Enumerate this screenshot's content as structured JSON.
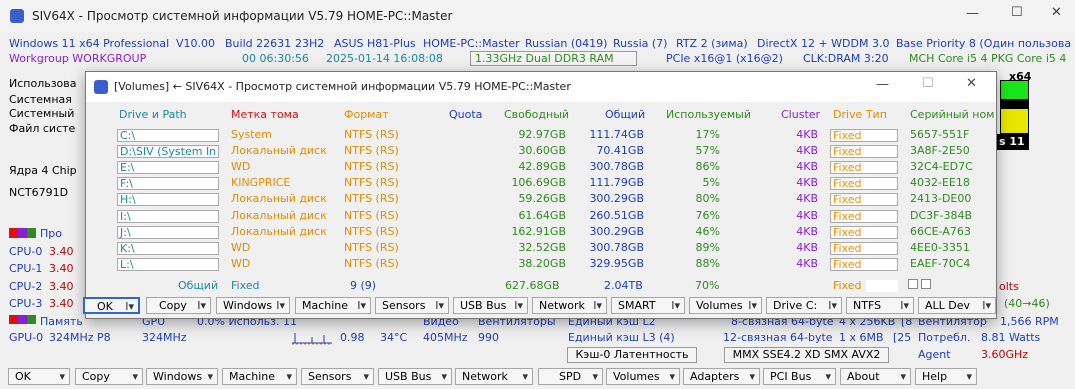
{
  "titlebar": {
    "title": "SIV64X - Просмотр системной информации V5.79 HOME-PC::Master"
  },
  "main": {
    "row1": [
      "Windows 11 x64 Professional",
      "V10.00",
      "Build 22631",
      "23H2",
      "ASUS H81-Plus",
      "HOME-PC::Master",
      "Russian (0419)",
      "Russia (7)",
      "RTZ 2 (зима)",
      "DirectX 12 + WDDM 3.0",
      "Base Priority 8 (Один пользова"
    ],
    "row2": {
      "workgroup": "Workgroup WORKGROUP",
      "uptime": "00 06:30:56",
      "datetime": "2025-01-14 16:08:08",
      "memory": "1.33GHz Dual DDR3 RAM",
      "pcie": "PCIe x16@1 (x16@2)",
      "clk": "CLK:DRAM 3:20",
      "mch": "MCH Core i5 4",
      "pkg": "PKG Core i5 4"
    },
    "left_labels": [
      "Использова",
      "Системная",
      "Системный",
      "Файл систе",
      "Ядра 4 Chip",
      "NCT6791D",
      "Про"
    ],
    "cpu_labels": [
      "CPU-0",
      "CPU-1",
      "CPU-2",
      "CPU-3"
    ],
    "cpu_values": [
      "3.40",
      "3.40",
      "3.40",
      "3.40"
    ],
    "x64_label": "x64",
    "cores_label": "s 11",
    "volts_label": "olts",
    "pcie_range": "(40→46)",
    "bottom_row1": {
      "memory": "Память",
      "gpu": "GPU",
      "usage": "0.0% Использ. 11",
      "video": "Видео",
      "fans": "Вентиляторы",
      "l2": "Единый кэш L2",
      "l2assoc": "8-связная 64-byte",
      "l2size": "4 x 256KB",
      "l2idx": "[8",
      "fan": "Вентилятор",
      "rpm": "1,566 RPM"
    },
    "bottom_row2": {
      "gpu0": "GPU-0",
      "gpuclk": "324MHz P8",
      "gpuclk2": "324MHz",
      "volt": "0.98",
      "temp": "34°C",
      "vclk": "405MHz",
      "fanval": "990",
      "l3": "Единый кэш L3 (4)",
      "l3assoc": "12-связная 64-byte",
      "l3size": "1 x 6MB",
      "l3idx": "[25",
      "power_label": "Потребл.",
      "power": "8.81 Watts"
    },
    "bottom_row3": {
      "latency_button": "Кэш-0 Латентность",
      "isa": "MMX SSE4.2 XD SMX AVX2",
      "agent": "Agent",
      "agent_freq": "3.60GHz"
    },
    "buttons": [
      "OK",
      "Copy",
      "Windows",
      "Machine",
      "Sensors",
      "USB Bus",
      "Network",
      "SPD",
      "Volumes",
      "Adapters",
      "PCI Bus",
      "About",
      "Help"
    ]
  },
  "volumes": {
    "title": "[Volumes] ← SIV64X - Просмотр системной информации V5.79 HOME-PC::Master",
    "headers": {
      "drive": "Drive и Path",
      "label": "Метка тома",
      "format": "Формат",
      "quota": "Quota",
      "free": "Свободный",
      "total": "Общий",
      "used": "Используемый",
      "cluster": "Cluster",
      "type": "Drive Тип",
      "serial": "Серийный ном"
    },
    "rows": [
      {
        "drive": "C:\\",
        "label": "System",
        "format": "NTFS (RS)",
        "free": "92.97GB",
        "total": "111.74GB",
        "used": "17%",
        "cluster": "4KB",
        "type": "Fixed",
        "serial": "5657-551F"
      },
      {
        "drive": "D:\\SIV (System In",
        "label": "Локальный диск",
        "format": "NTFS (RS)",
        "free": "30.60GB",
        "total": "70.41GB",
        "used": "57%",
        "cluster": "4KB",
        "type": "Fixed",
        "serial": "3A8F-2E50"
      },
      {
        "drive": "E:\\",
        "label": "WD",
        "format": "NTFS (RS)",
        "free": "42.89GB",
        "total": "300.78GB",
        "used": "86%",
        "cluster": "4KB",
        "type": "Fixed",
        "serial": "32C4-ED7C"
      },
      {
        "drive": "F:\\",
        "label": "KINGPRICE",
        "format": "NTFS (RS)",
        "free": "106.69GB",
        "total": "111.79GB",
        "used": "5%",
        "cluster": "4KB",
        "type": "Fixed",
        "serial": "4032-EE18"
      },
      {
        "drive": "H:\\",
        "label": "Локальный диск",
        "format": "NTFS (RS)",
        "free": "59.26GB",
        "total": "300.29GB",
        "used": "80%",
        "cluster": "4KB",
        "type": "Fixed",
        "serial": "2413-DE00"
      },
      {
        "drive": "I:\\",
        "label": "Локальный диск",
        "format": "NTFS (RS)",
        "free": "61.64GB",
        "total": "260.51GB",
        "used": "76%",
        "cluster": "4KB",
        "type": "Fixed",
        "serial": "DC3F-384B"
      },
      {
        "drive": "J:\\",
        "label": "Локальный диск",
        "format": "NTFS (RS)",
        "free": "162.91GB",
        "total": "300.29GB",
        "used": "46%",
        "cluster": "4KB",
        "type": "Fixed",
        "serial": "66CE-A763"
      },
      {
        "drive": "K:\\",
        "label": "WD",
        "format": "NTFS (RS)",
        "free": "32.52GB",
        "total": "300.78GB",
        "used": "89%",
        "cluster": "4KB",
        "type": "Fixed",
        "serial": "4EE0-3351"
      },
      {
        "drive": "L:\\",
        "label": "WD",
        "format": "NTFS (RS)",
        "free": "38.20GB",
        "total": "329.95GB",
        "used": "88%",
        "cluster": "4KB",
        "type": "Fixed",
        "serial": "EAEF-70C4"
      }
    ],
    "totals": {
      "label": "Общий",
      "type": "Fixed",
      "count": "9 (9)",
      "free": "627.68GB",
      "total": "2.04TB",
      "used": "70%",
      "fixed": "Fixed"
    },
    "buttons": [
      "OK",
      "Copy",
      "Windows",
      "Machine",
      "Sensors",
      "USB Bus",
      "Network",
      "SMART",
      "Volumes",
      "Drive C:",
      "NTFS",
      "ALL Dev"
    ]
  },
  "colors": {
    "blue": "#1a3cc8",
    "orange": "#e68a00",
    "green": "#2e8b1e",
    "purple": "#8a1ed6",
    "teal": "#1a8aa0",
    "red": "#e01010",
    "yellow": "#e6e600",
    "darkred": "#c80000"
  }
}
